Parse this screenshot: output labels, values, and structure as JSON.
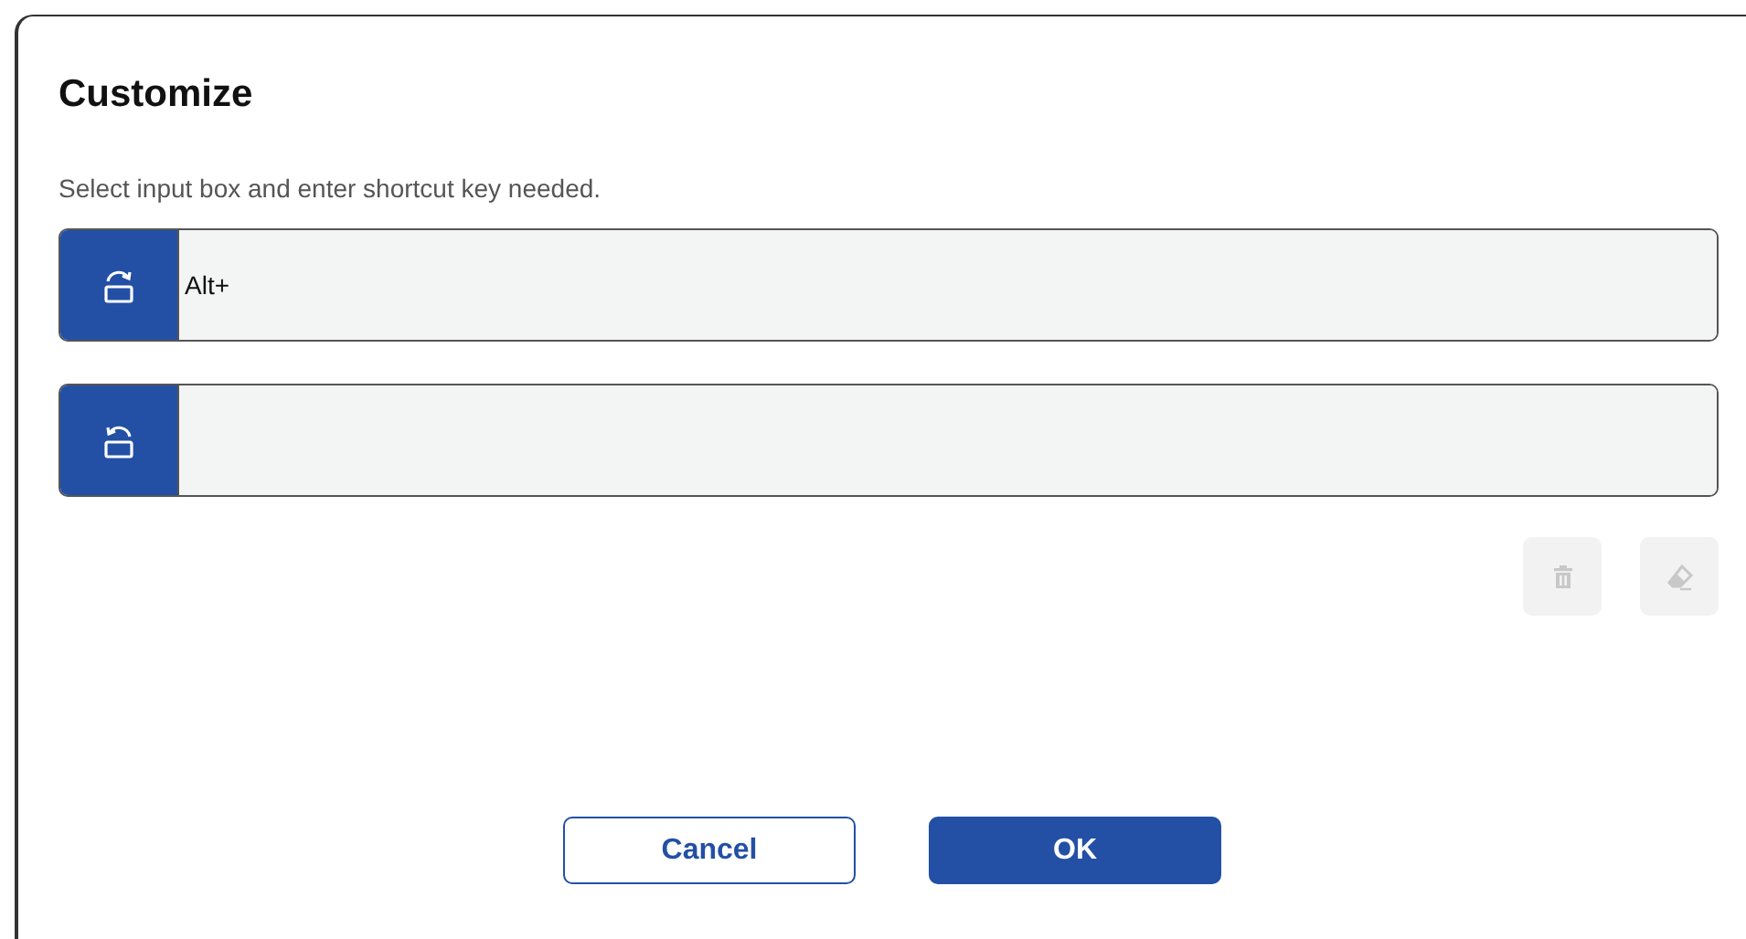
{
  "dialog": {
    "title": "Customize",
    "instruction": "Select input box and enter shortcut key needed.",
    "fields": [
      {
        "kind": "rotate-right",
        "value": "Alt+"
      },
      {
        "kind": "rotate-left"
      }
    ],
    "tools": [
      {
        "kind": "delete",
        "disabled": true
      },
      {
        "kind": "erase",
        "disabled": true
      }
    ],
    "buttons": [
      {
        "label": "Cancel",
        "kind": "secondary"
      },
      {
        "label": "OK",
        "kind": "primary"
      }
    ]
  }
}
